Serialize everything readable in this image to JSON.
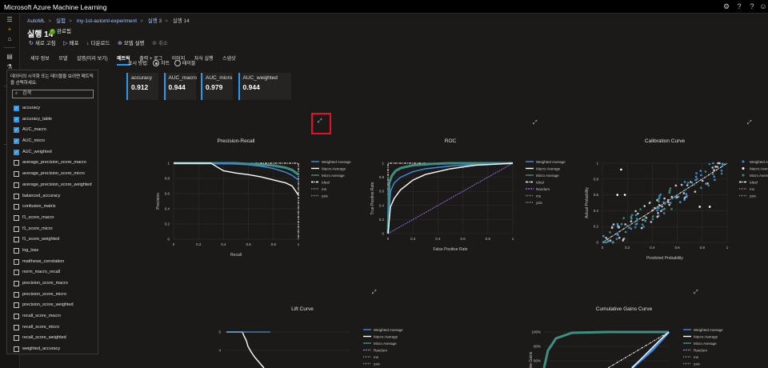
{
  "app": {
    "title": "Microsoft Azure Machine Learning"
  },
  "breadcrumb": [
    "AutoML",
    "실험",
    "my-1st-automl-experiment",
    "실행 3",
    "실행 14"
  ],
  "run": {
    "title": "실행 14",
    "status": "완료됨"
  },
  "actions": [
    "새로 고침",
    "배포",
    "다운로드",
    "모델 설명",
    "취소"
  ],
  "tabs": [
    "세부 정보",
    "모델",
    "설명(미리 보기)",
    "메트릭",
    "출력 + 로그",
    "이미지",
    "자식 실행",
    "스냅샷"
  ],
  "left_panel": {
    "description": "데이터의 시각화 또는 테이블을 보려면 메트릭을 선택하세요.",
    "search_placeholder": "검색",
    "metrics": [
      {
        "name": "accuracy",
        "checked": true
      },
      {
        "name": "accuracy_table",
        "checked": true
      },
      {
        "name": "AUC_macro",
        "checked": true
      },
      {
        "name": "AUC_micro",
        "checked": true
      },
      {
        "name": "AUC_weighted",
        "checked": true
      },
      {
        "name": "average_precision_score_macro",
        "checked": false
      },
      {
        "name": "average_precision_score_micro",
        "checked": false
      },
      {
        "name": "average_precision_score_weighted",
        "checked": false
      },
      {
        "name": "balanced_accuracy",
        "checked": false
      },
      {
        "name": "confusion_matrix",
        "checked": false
      },
      {
        "name": "f1_score_macro",
        "checked": false
      },
      {
        "name": "f1_score_micro",
        "checked": false
      },
      {
        "name": "f1_score_weighted",
        "checked": false
      },
      {
        "name": "log_loss",
        "checked": false
      },
      {
        "name": "matthews_correlation",
        "checked": false
      },
      {
        "name": "norm_macro_recall",
        "checked": false
      },
      {
        "name": "precision_score_macro",
        "checked": false
      },
      {
        "name": "precision_score_micro",
        "checked": false
      },
      {
        "name": "precision_score_weighted",
        "checked": false
      },
      {
        "name": "recall_score_macro",
        "checked": false
      },
      {
        "name": "recall_score_micro",
        "checked": false
      },
      {
        "name": "recall_score_weighted",
        "checked": false
      },
      {
        "name": "weighted_accuracy",
        "checked": false
      }
    ]
  },
  "view": {
    "label": "표시 방법:",
    "options": [
      "차트",
      "테이블"
    ],
    "selected": "차트"
  },
  "metric_cards": [
    {
      "label": "accuracy",
      "value": "0.912"
    },
    {
      "label": "AUC_macro",
      "value": "0.944"
    },
    {
      "label": "AUC_micro",
      "value": "0.979"
    },
    {
      "label": "AUC_weighted",
      "value": "0.944"
    }
  ],
  "colors": {
    "accent": "#2899f5",
    "weighted": "#3a8ee6",
    "macro": "#ffffff",
    "micro": "#3d8f7f",
    "ideal": "#ffffff",
    "random": "#8c6bd6"
  },
  "chart_data": [
    {
      "type": "line",
      "title": "Precision-Recall",
      "xlabel": "Recall",
      "ylabel": "Precision",
      "xlim": [
        0,
        1
      ],
      "ylim": [
        0,
        1
      ],
      "xticks": [
        "0",
        "0.2",
        "0.4",
        "0.6",
        "0.8",
        "1"
      ],
      "yticks": [
        "0",
        "0.2",
        "0.4",
        "0.6",
        "0.8",
        "1"
      ],
      "legend": [
        "Weighted Average",
        "Macro Average",
        "Micro Average",
        "Ideal",
        "ms",
        "ysis"
      ],
      "series": [
        {
          "name": "Weighted Average",
          "x": [
            0,
            0.3,
            0.5,
            0.6,
            0.7,
            0.8,
            0.9,
            0.95,
            1
          ],
          "y": [
            1,
            1,
            0.99,
            0.98,
            0.96,
            0.93,
            0.88,
            0.84,
            0.78
          ]
        },
        {
          "name": "Macro Average",
          "x": [
            0,
            0.3,
            0.35,
            0.4,
            0.5,
            0.6,
            0.7,
            0.8,
            0.9,
            0.95,
            1
          ],
          "y": [
            1,
            1,
            0.95,
            0.9,
            0.87,
            0.85,
            0.82,
            0.78,
            0.74,
            0.7,
            0.58
          ]
        },
        {
          "name": "Micro Average",
          "x": [
            0,
            0.5,
            0.6,
            0.7,
            0.8,
            0.9,
            0.95,
            1
          ],
          "y": [
            1,
            1,
            0.99,
            0.98,
            0.97,
            0.94,
            0.91,
            0.85
          ]
        }
      ]
    },
    {
      "type": "line",
      "title": "ROC",
      "xlabel": "False Positive Rate",
      "ylabel": "True Positive Rate",
      "xlim": [
        0,
        1
      ],
      "ylim": [
        0,
        1
      ],
      "xticks": [
        "0",
        "0.2",
        "0.4",
        "0.6",
        "0.8",
        "1"
      ],
      "yticks": [
        "0",
        "0.2",
        "0.4",
        "0.6",
        "0.8",
        "1"
      ],
      "legend": [
        "Weighted Average",
        "Macro Average",
        "Micro Average",
        "Ideal",
        "Random",
        "ms",
        "ysis"
      ],
      "series": [
        {
          "name": "Weighted Average",
          "x": [
            0,
            0.02,
            0.05,
            0.1,
            0.2,
            0.3,
            0.5,
            0.7,
            0.9,
            1
          ],
          "y": [
            0,
            0.6,
            0.72,
            0.8,
            0.88,
            0.92,
            0.96,
            0.98,
            0.995,
            1
          ]
        },
        {
          "name": "Macro Average",
          "x": [
            0,
            0.02,
            0.05,
            0.1,
            0.2,
            0.3,
            0.5,
            0.7,
            0.9,
            1
          ],
          "y": [
            0,
            0.38,
            0.5,
            0.62,
            0.76,
            0.84,
            0.92,
            0.97,
            0.99,
            1
          ]
        },
        {
          "name": "Micro Average",
          "x": [
            0,
            0.01,
            0.03,
            0.06,
            0.1,
            0.2,
            0.35,
            0.5,
            1
          ],
          "y": [
            0,
            0.72,
            0.82,
            0.89,
            0.93,
            0.97,
            0.99,
            1,
            1
          ]
        }
      ]
    },
    {
      "type": "scatter",
      "title": "Calibration Curve",
      "xlabel": "Predicted Probability",
      "ylabel": "Actual Probability",
      "xlim": [
        0,
        1
      ],
      "ylim": [
        0,
        1
      ],
      "xticks": [
        "0",
        "0.2",
        "0.4",
        "0.6",
        "0.8",
        "1"
      ],
      "yticks": [
        "0",
        "0.2",
        "0.4",
        "0.6",
        "0.8",
        "1"
      ],
      "legend": [
        "Weighted Average",
        "Macro Average",
        "Micro Average",
        "Ideal",
        "ms",
        "ysis"
      ]
    },
    {
      "type": "line",
      "title": "Lift Curve",
      "yticks": [
        "5",
        "4"
      ],
      "legend": [
        "Weighted Average",
        "Macro Average",
        "Micro Average",
        "Random",
        "ms",
        "ysis"
      ]
    },
    {
      "type": "line",
      "title": "Cumulative Gains Curve",
      "ylabel": "ive Gains",
      "yticks": [
        "100%",
        "80%",
        "60%"
      ],
      "legend": [
        "Weighted Average",
        "Macro Average",
        "Micro Average",
        "Random",
        "ms",
        "ysis"
      ]
    }
  ]
}
